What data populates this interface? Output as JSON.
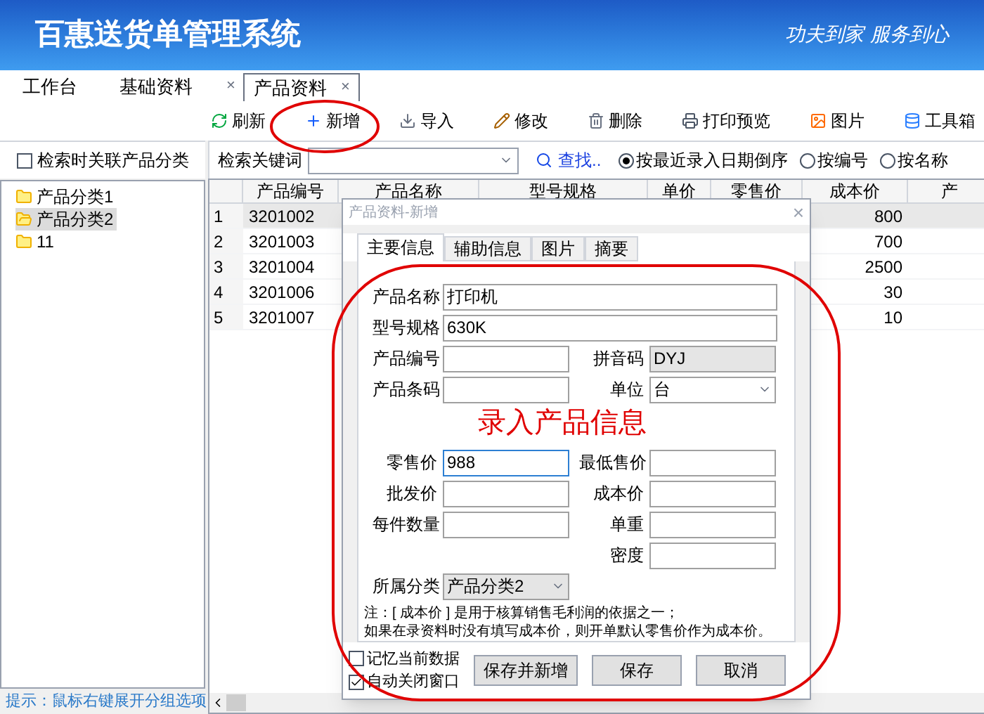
{
  "app": {
    "title": "百惠送货单管理系统",
    "slogan": "功夫到家 服务到心"
  },
  "tabs": [
    {
      "label": "工作台",
      "selected": false
    },
    {
      "label": "基础资料",
      "selected": false
    },
    {
      "label": "产品资料",
      "selected": true,
      "close": "×"
    }
  ],
  "tab_close": "×",
  "toolbar": [
    {
      "label": "刷新",
      "kind": "refresh"
    },
    {
      "label": "新增",
      "kind": "add"
    },
    {
      "label": "导入",
      "kind": "import"
    },
    {
      "label": "修改",
      "kind": "edit"
    },
    {
      "label": "删除",
      "kind": "delete"
    },
    {
      "label": "打印预览",
      "kind": "print"
    },
    {
      "label": "图片",
      "kind": "image"
    },
    {
      "label": "工具箱",
      "kind": "toolbox"
    }
  ],
  "sidebar": {
    "filter": {
      "label": "检索时关联产品分类",
      "checked": false
    },
    "tree": [
      {
        "label": "产品分类1",
        "selected": false
      },
      {
        "label": "产品分类2",
        "selected": true
      },
      {
        "label": "11",
        "selected": false
      }
    ],
    "hint": "提示：鼠标右键展开分组选项"
  },
  "search": {
    "label": "检索关键词",
    "find": "查找..",
    "sort": [
      {
        "label": "按最近录入日期倒序",
        "selected": true
      },
      {
        "label": "按编号",
        "selected": false
      },
      {
        "label": "按名称",
        "selected": false
      }
    ]
  },
  "table": {
    "columns": [
      "",
      "产品编号",
      "产品名称",
      "型号规格",
      "单价",
      "零售价",
      "成本价",
      "产"
    ],
    "rows": [
      {
        "row_no": "1",
        "code": "3201002",
        "cost": "800",
        "selected": true
      },
      {
        "row_no": "2",
        "code": "3201003",
        "cost": "700",
        "selected": false
      },
      {
        "row_no": "3",
        "code": "3201004",
        "cost": "2500",
        "selected": false
      },
      {
        "row_no": "4",
        "code": "3201006",
        "cost": "30",
        "selected": false
      },
      {
        "row_no": "5",
        "code": "3201007",
        "cost": "10",
        "selected": false
      }
    ]
  },
  "dialog": {
    "title": "产品资料-新增",
    "close": "×",
    "tabs": [
      {
        "label": "主要信息",
        "selected": true
      },
      {
        "label": "辅助信息",
        "selected": false
      },
      {
        "label": "图片",
        "selected": false
      },
      {
        "label": "摘要",
        "selected": false
      }
    ],
    "field_groups": [
      [
        {
          "left": {
            "label": "产品名称",
            "value": "打印机",
            "kind": "text",
            "focused": false
          }
        },
        {
          "left": {
            "label": "型号规格",
            "value": "630K",
            "kind": "text",
            "focused": false
          }
        },
        {
          "left": {
            "label": "产品编号",
            "kind": "text",
            "focused": false
          },
          "right": {
            "label": "拼音码",
            "value": "DYJ",
            "kind": "readonly",
            "focused": false
          }
        },
        {
          "left": {
            "label": "产品条码",
            "kind": "text",
            "focused": false
          },
          "right": {
            "label": "单位",
            "value": "台",
            "kind": "select",
            "focused": false
          }
        }
      ],
      [
        {
          "left": {
            "label": "零售价",
            "value": "988",
            "kind": "text",
            "focused": true
          },
          "right": {
            "label": "最低售价",
            "kind": "text",
            "focused": false
          }
        },
        {
          "left": {
            "label": "批发价",
            "kind": "text",
            "focused": false
          },
          "right": {
            "label": "成本价",
            "kind": "text",
            "focused": false
          }
        },
        {
          "left": {
            "label": "每件数量",
            "kind": "text",
            "focused": false
          },
          "right": {
            "label": "单重",
            "kind": "text",
            "focused": false
          }
        },
        {
          "right": {
            "label": "密度",
            "kind": "text",
            "focused": false
          }
        },
        {
          "left": {
            "label": "所属分类",
            "value": "产品分类2",
            "kind": "select",
            "focused": false
          }
        }
      ]
    ],
    "note": [
      "注：[ 成本价 ] 是用于核算销售毛利润的依据之一；",
      "如果在录资料时没有填写成本价，则开单默认零售价作为成本价。"
    ],
    "options": [
      {
        "label": "记忆当前数据",
        "checked": false
      },
      {
        "label": "自动关闭窗口",
        "checked": true
      }
    ],
    "buttons": [
      "保存并新增",
      "保存",
      "取消"
    ]
  },
  "annotation": {
    "text": "录入产品信息"
  }
}
